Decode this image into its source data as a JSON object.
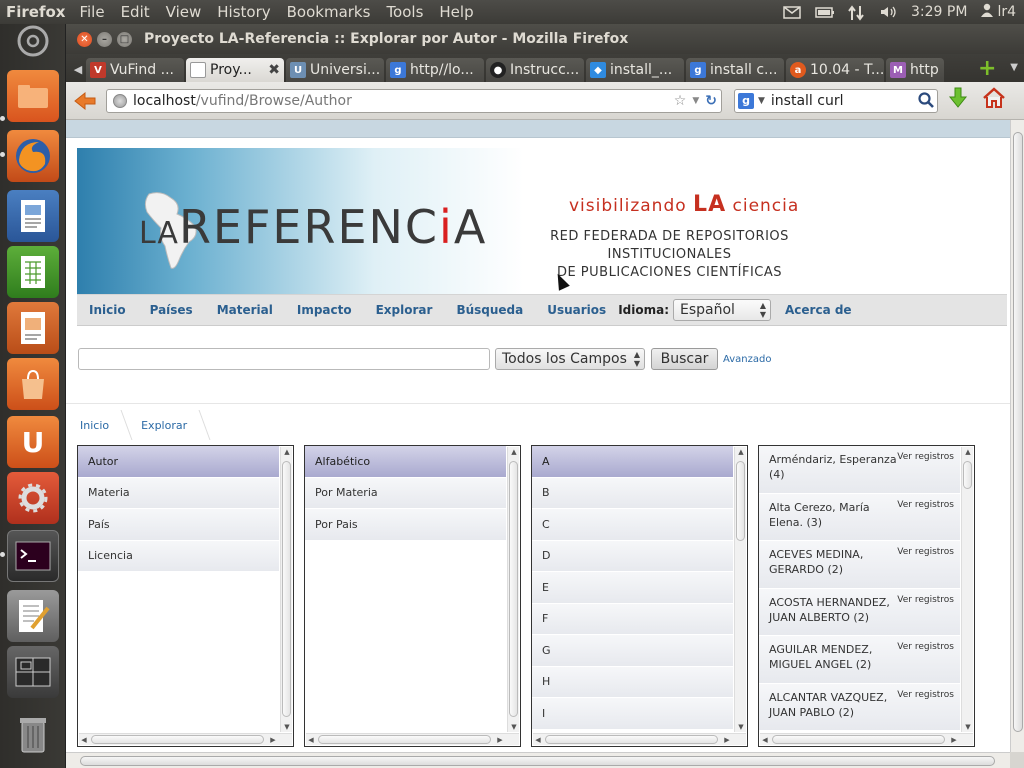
{
  "top_panel": {
    "app_name": "Firefox",
    "menus": [
      "File",
      "Edit",
      "View",
      "History",
      "Bookmarks",
      "Tools",
      "Help"
    ],
    "clock": "3:29 PM",
    "user": "lr4"
  },
  "window": {
    "title": "Proyecto LA-Referencia :: Explorar por Autor - Mozilla Firefox"
  },
  "tabs": [
    {
      "label": "VuFind ...",
      "favicon": "vufind-icon",
      "active": false
    },
    {
      "label": "Proy...",
      "favicon": "blank-page-icon",
      "active": true
    },
    {
      "label": "Universi...",
      "favicon": "university-icon",
      "active": false
    },
    {
      "label": "http//lo...",
      "favicon": "google-icon",
      "active": false
    },
    {
      "label": "Instrucc...",
      "favicon": "github-icon",
      "active": false
    },
    {
      "label": "install_...",
      "favicon": "dropbox-icon",
      "active": false
    },
    {
      "label": "install c...",
      "favicon": "google-icon",
      "active": false
    },
    {
      "label": "10.04 - T...",
      "favicon": "askubuntu-icon",
      "active": false
    },
    {
      "label": "http",
      "favicon": "site-icon",
      "active": false
    }
  ],
  "navbar": {
    "url_host": "localhost",
    "url_path": "/vufind/Browse/Author",
    "search_query": "install curl"
  },
  "page": {
    "banner": {
      "logo_prefix": "LA",
      "logo_main": "REFERENC",
      "logo_dot": "i",
      "logo_end": "A",
      "tagline_pre": "visibilizando ",
      "tagline_la": "LA",
      "tagline_post": " ciencia",
      "subtitle_line1": "RED FEDERADA DE REPOSITORIOS INSTITUCIONALES",
      "subtitle_line2": "DE PUBLICACIONES CIENTÍFICAS"
    },
    "nav": {
      "items": [
        "Inicio",
        "Países",
        "Material",
        "Impacto",
        "Explorar",
        "Búsqueda",
        "Usuarios"
      ],
      "language_label": "Idioma:",
      "language_value": "Español",
      "about": "Acerca de"
    },
    "search": {
      "query": "",
      "field_value": "Todos los Campos",
      "button": "Buscar",
      "advanced": "Avanzado"
    },
    "breadcrumb": [
      "Inicio",
      "Explorar"
    ],
    "browse": {
      "col1": [
        "Autor",
        "Materia",
        "País",
        "Licencia"
      ],
      "col2": [
        "Alfabético",
        "Por Materia",
        "Por Pais"
      ],
      "col3": [
        "A",
        "B",
        "C",
        "D",
        "E",
        "F",
        "G",
        "H",
        "I"
      ],
      "view_label": "Ver registros",
      "authors": [
        {
          "name": "Arméndariz, Esperanza",
          "count": "(4)"
        },
        {
          "name": "Alta Cerezo, María Elena.",
          "count": "(3)"
        },
        {
          "name": "ACEVES MEDINA, GERARDO",
          "count": "(2)"
        },
        {
          "name": "ACOSTA HERNANDEZ, JUAN ALBERTO",
          "count": "(2)"
        },
        {
          "name": "AGUILAR MENDEZ, MIGUEL ANGEL",
          "count": "(2)"
        },
        {
          "name": "ALCANTAR VAZQUEZ, JUAN PABLO",
          "count": "(2)"
        }
      ]
    }
  },
  "colors": {
    "selected_item": "#a9a9cf",
    "link_blue": "#2b5f8f",
    "brand_red": "#c63020"
  }
}
